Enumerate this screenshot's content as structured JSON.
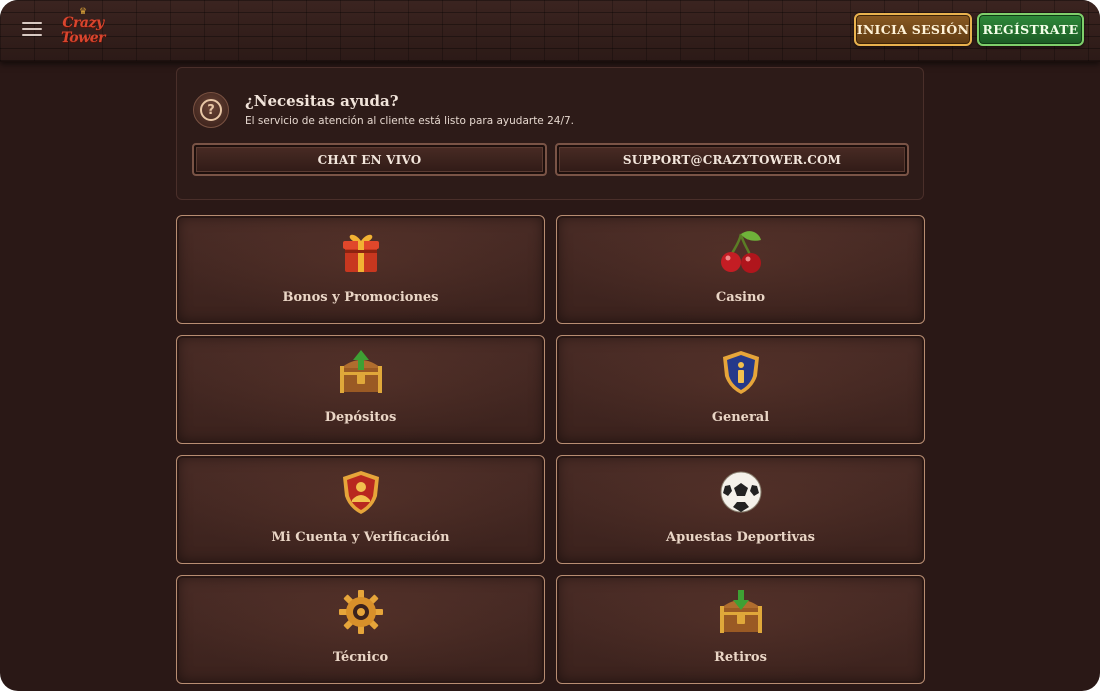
{
  "header": {
    "logo_line1": "Crazy",
    "logo_line2": "Tower",
    "login_label": "INICIA SESIÓN",
    "register_label": "REGÍSTRATE"
  },
  "help": {
    "title": "¿Necesitas ayuda?",
    "subtitle": "El servicio de atención al cliente está listo para ayudarte 24/7.",
    "chat_label": "CHAT EN VIVO",
    "email_label": "SUPPORT@CRAZYTOWER.COM"
  },
  "categories": [
    {
      "label": "Bonos y Promociones",
      "icon": "gift-icon"
    },
    {
      "label": "Casino",
      "icon": "cherries-icon"
    },
    {
      "label": "Depósitos",
      "icon": "treasure-chest-up-icon"
    },
    {
      "label": "General",
      "icon": "info-shield-icon"
    },
    {
      "label": "Mi Cuenta y Verificación",
      "icon": "account-shield-icon"
    },
    {
      "label": "Apuestas Deportivas",
      "icon": "soccer-ball-icon"
    },
    {
      "label": "Técnico",
      "icon": "gear-icon"
    },
    {
      "label": "Retiros",
      "icon": "treasure-chest-down-icon"
    }
  ],
  "colors": {
    "background": "#2a1816",
    "card_border": "#b88d72",
    "login_border": "#e9b24e",
    "register_bg": "#2e8a3a"
  }
}
